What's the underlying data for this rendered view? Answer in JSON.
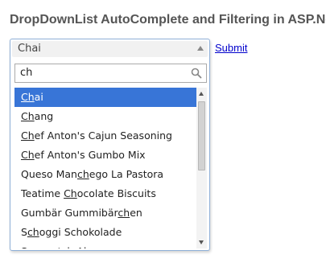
{
  "page": {
    "title": "DropDownList AutoComplete and Filtering in ASP.Net"
  },
  "dropdown": {
    "selected_value": "Chai",
    "search_value": "ch",
    "search_icon": "search-icon",
    "results": [
      {
        "label": "Chai",
        "match": "Ch",
        "selected": true
      },
      {
        "label": "Chang",
        "match": "Ch",
        "selected": false
      },
      {
        "label": "Chef Anton's Cajun Seasoning",
        "match": "Ch",
        "selected": false
      },
      {
        "label": "Chef Anton's Gumbo Mix",
        "match": "Ch",
        "selected": false
      },
      {
        "label": "Queso Manchego La Pastora",
        "match": "ch",
        "selected": false
      },
      {
        "label": "Teatime Chocolate Biscuits",
        "match": "Ch",
        "selected": false
      },
      {
        "label": "Gumbär Gummibärchen",
        "match": "ch",
        "selected": false
      },
      {
        "label": "Schoggi Schokolade",
        "match": "ch",
        "selected": false
      },
      {
        "label": "Sasquatch Ale",
        "match": "ch",
        "selected": false
      }
    ],
    "highlight_color": "#3875d7"
  },
  "actions": {
    "submit_label": "Submit"
  }
}
